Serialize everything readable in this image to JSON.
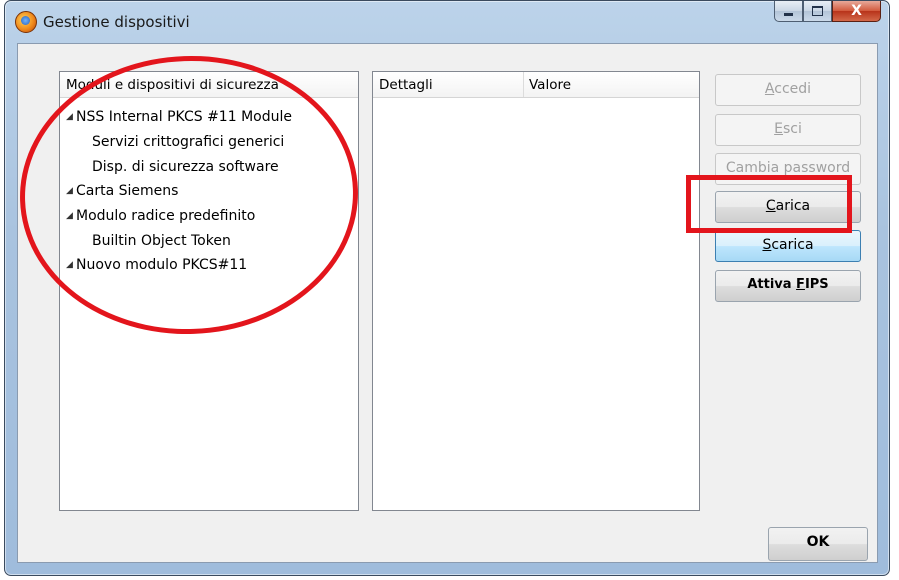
{
  "window": {
    "title": "Gestione dispositivi",
    "icon": "firefox-icon",
    "controls": [
      "minimize-icon",
      "maximize-icon",
      "close-icon"
    ],
    "close_glyph": "X"
  },
  "tree": {
    "header": "Moduli e dispositivi di sicurezza",
    "items": [
      {
        "label": "NSS Internal PKCS #11 Module",
        "level": 0,
        "expanded": true
      },
      {
        "label": "Servizi crittografici generici",
        "level": 1
      },
      {
        "label": "Disp. di sicurezza software",
        "level": 1
      },
      {
        "label": "Carta Siemens",
        "level": 0,
        "expanded": true
      },
      {
        "label": "Modulo radice predefinito",
        "level": 0,
        "expanded": true
      },
      {
        "label": "Builtin Object Token",
        "level": 1
      },
      {
        "label": "Nuovo modulo PKCS#11",
        "level": 0,
        "expanded": true
      }
    ]
  },
  "details": {
    "col1": "Dettagli",
    "col2": "Valore"
  },
  "buttons": {
    "accedi": {
      "prefix": "",
      "key": "A",
      "rest": "ccedi",
      "enabled": false
    },
    "esci": {
      "prefix": "",
      "key": "E",
      "rest": "sci",
      "enabled": false
    },
    "cambia_password": {
      "label": "Cambia password",
      "enabled": false
    },
    "carica": {
      "prefix": "",
      "key": "C",
      "rest": "arica",
      "enabled": true
    },
    "scarica": {
      "prefix": "",
      "key": "S",
      "rest": "carica",
      "enabled": true
    },
    "attiva_fips": {
      "prefix": "Attiva ",
      "key": "F",
      "rest": "IPS",
      "enabled": true
    },
    "ok": "OK"
  },
  "annotation_color": "#e3151c"
}
